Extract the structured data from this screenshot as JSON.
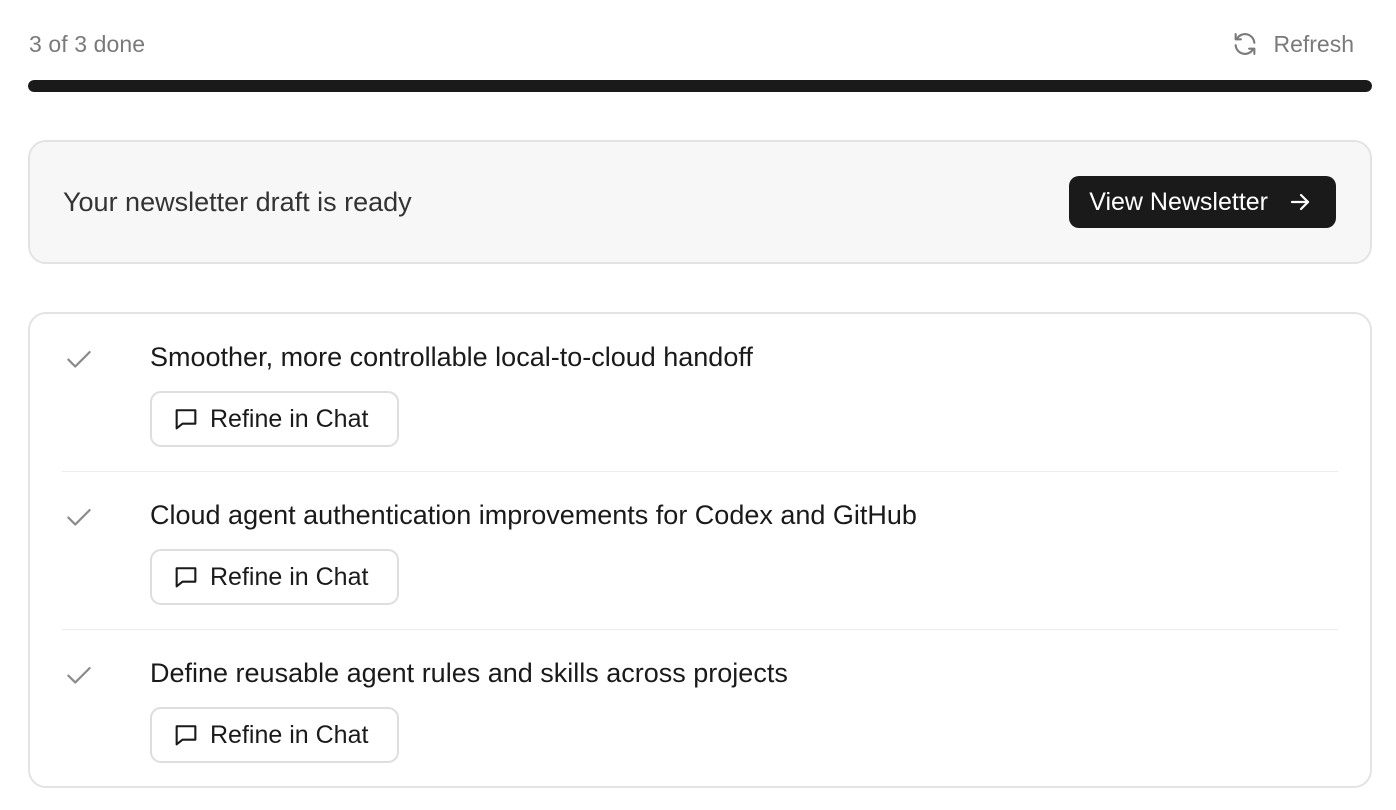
{
  "header": {
    "progress_label": "3 of 3 done",
    "refresh_label": "Refresh",
    "refresh_icon": "refresh-icon"
  },
  "progress": {
    "completed": 3,
    "total": 3,
    "fraction": 1.0
  },
  "banner": {
    "message": "Your newsletter draft is ready",
    "view_button_label": "View Newsletter",
    "view_button_icon": "arrow-right-icon"
  },
  "items": [
    {
      "title": "Smoother, more controllable local-to-cloud handoff",
      "status_icon": "check-icon",
      "refine_label": "Refine in Chat",
      "refine_icon": "chat-bubble-icon"
    },
    {
      "title": "Cloud agent authentication improvements for Codex and GitHub",
      "status_icon": "check-icon",
      "refine_label": "Refine in Chat",
      "refine_icon": "chat-bubble-icon"
    },
    {
      "title": "Define reusable agent rules and skills across projects",
      "status_icon": "check-icon",
      "refine_label": "Refine in Chat",
      "refine_icon": "chat-bubble-icon"
    }
  ],
  "colors": {
    "primary": "#1a1a1a",
    "muted_text": "#7a7a7a",
    "banner_bg": "#f7f7f7",
    "border": "#e3e3e3",
    "check": "#8a8a8a"
  }
}
